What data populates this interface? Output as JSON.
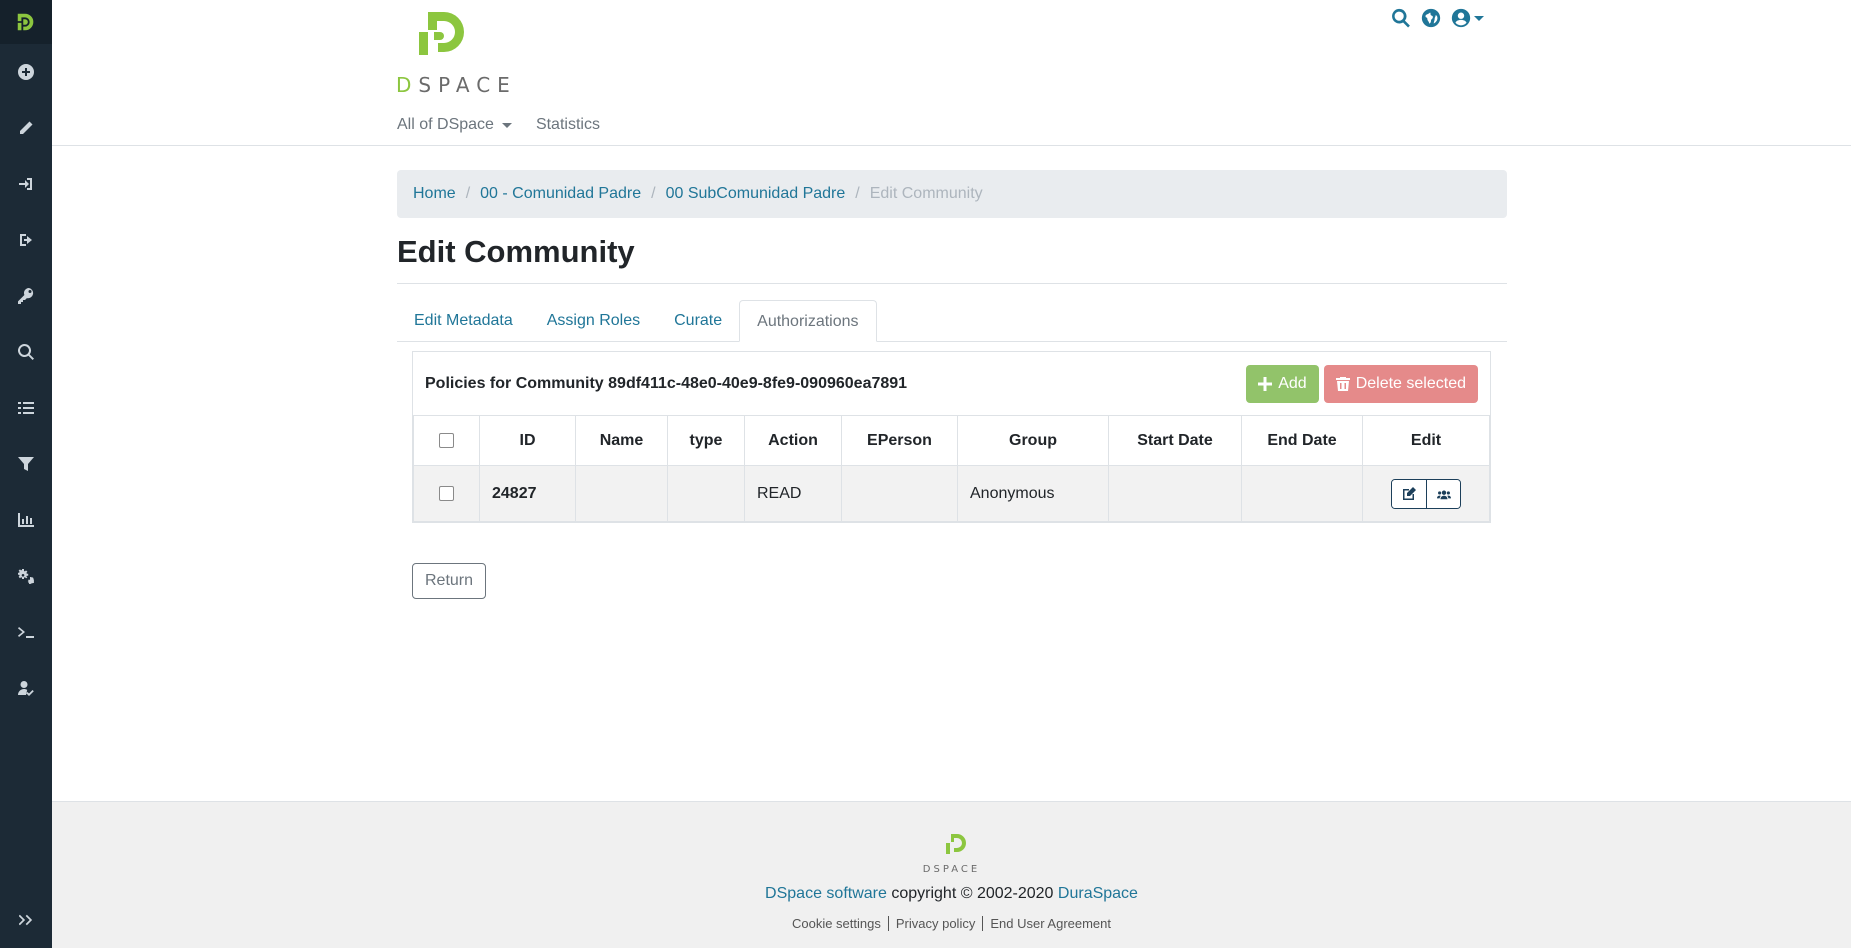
{
  "sidebar": {
    "items": [
      {
        "name": "new-icon"
      },
      {
        "name": "edit-icon"
      },
      {
        "name": "import-icon"
      },
      {
        "name": "export-icon"
      },
      {
        "name": "access-control-icon"
      },
      {
        "name": "admin-search-icon"
      },
      {
        "name": "registries-icon"
      },
      {
        "name": "curation-task-icon"
      },
      {
        "name": "statistics-icon"
      },
      {
        "name": "workflow-icon"
      },
      {
        "name": "processes-icon"
      },
      {
        "name": "health-icon"
      }
    ]
  },
  "header": {
    "logo_d": "D",
    "logo_rest": "SPACE",
    "nav": {
      "all_of_dspace": "All of DSpace",
      "statistics": "Statistics"
    }
  },
  "breadcrumb": {
    "home": "Home",
    "community": "00 - Comunidad Padre",
    "subcommunity": "00 SubComunidad Padre",
    "current": "Edit Community"
  },
  "page": {
    "title": "Edit Community",
    "tabs": [
      {
        "label": "Edit Metadata"
      },
      {
        "label": "Assign Roles"
      },
      {
        "label": "Curate"
      },
      {
        "label": "Authorizations"
      }
    ],
    "active_tab": "Authorizations"
  },
  "policies": {
    "title": "Policies for Community 89df411c-48e0-40e9-8fe9-090960ea7891",
    "add_label": "Add",
    "delete_label": "Delete selected",
    "columns": [
      "ID",
      "Name",
      "type",
      "Action",
      "EPerson",
      "Group",
      "Start Date",
      "End Date",
      "Edit"
    ],
    "rows": [
      {
        "id": "24827",
        "name": "",
        "type": "",
        "action": "READ",
        "eperson": "",
        "group": "Anonymous",
        "start": "",
        "end": ""
      }
    ]
  },
  "return_label": "Return",
  "footer": {
    "logo_text": "DSPACE",
    "software_link": "DSpace software",
    "copyright": " copyright © 2002-2020 ",
    "duraspace_link": "DuraSpace",
    "links": [
      "Cookie settings",
      "Privacy policy",
      "End User Agreement"
    ]
  },
  "colors": {
    "sidebar_bg": "#1c2a36",
    "link": "#207698",
    "brand_green": "#8cc63f",
    "add_button": "#92c36a",
    "delete_button": "#e58a8a"
  }
}
